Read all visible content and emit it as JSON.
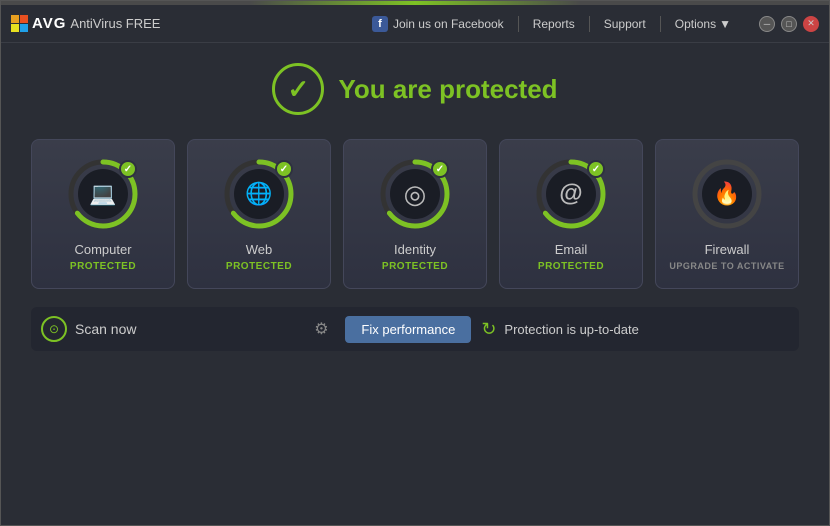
{
  "window": {
    "title": "AVG AntiVirus FREE",
    "accent_bar": "green accent"
  },
  "titlebar": {
    "logo": "AVG",
    "product_name": "AntiVirus FREE",
    "facebook_label": "Join us on Facebook",
    "reports_label": "Reports",
    "support_label": "Support",
    "options_label": "Options"
  },
  "header": {
    "status_text": "You are protected"
  },
  "cards": [
    {
      "id": "computer",
      "name": "Computer",
      "status": "PROTECTED",
      "icon": "💻",
      "protected": true
    },
    {
      "id": "web",
      "name": "Web",
      "status": "PROTECTED",
      "icon": "🌐",
      "protected": true
    },
    {
      "id": "identity",
      "name": "Identity",
      "status": "PROTECTED",
      "icon": "◎",
      "protected": true
    },
    {
      "id": "email",
      "name": "Email",
      "status": "PROTECTED",
      "icon": "@",
      "protected": true
    },
    {
      "id": "firewall",
      "name": "Firewall",
      "status": "UPGRADE TO ACTIVATE",
      "icon": "🔥",
      "protected": false
    }
  ],
  "bottombar": {
    "scan_label": "Scan now",
    "fix_label": "Fix performance",
    "update_label": "Protection is up-to-date"
  }
}
